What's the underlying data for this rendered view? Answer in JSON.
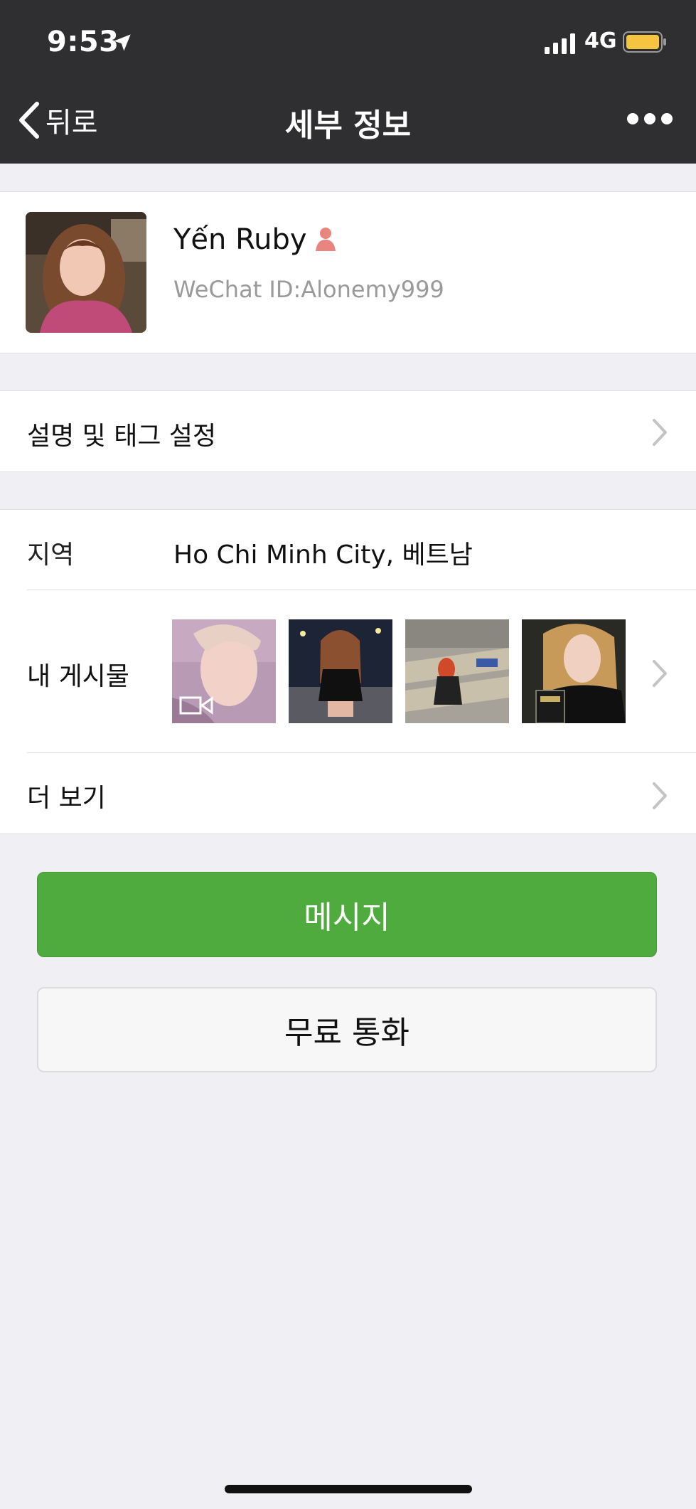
{
  "status_bar": {
    "time": "9:53",
    "network": "4G",
    "battery_color": "#f5c542"
  },
  "nav": {
    "back_label": "뒤로",
    "title": "세부 정보"
  },
  "profile": {
    "name": "Yến Ruby",
    "wechat_id": "WeChat ID:Alonemy999",
    "gender_icon": "female-icon",
    "gender_color": "#e8857e"
  },
  "tags_row": {
    "label": "설명 및 태그 설정"
  },
  "region": {
    "label": "지역",
    "value": "Ho Chi Minh City, 베트남"
  },
  "posts": {
    "label": "내 게시물",
    "thumbnails": [
      {
        "kind": "video",
        "icon": "video-camera-icon"
      },
      {
        "kind": "photo"
      },
      {
        "kind": "photo"
      },
      {
        "kind": "photo"
      }
    ]
  },
  "more_row": {
    "label": "더 보기"
  },
  "actions": {
    "message_label": "메시지",
    "call_label": "무료 통화",
    "accent": "#4fab3d"
  }
}
